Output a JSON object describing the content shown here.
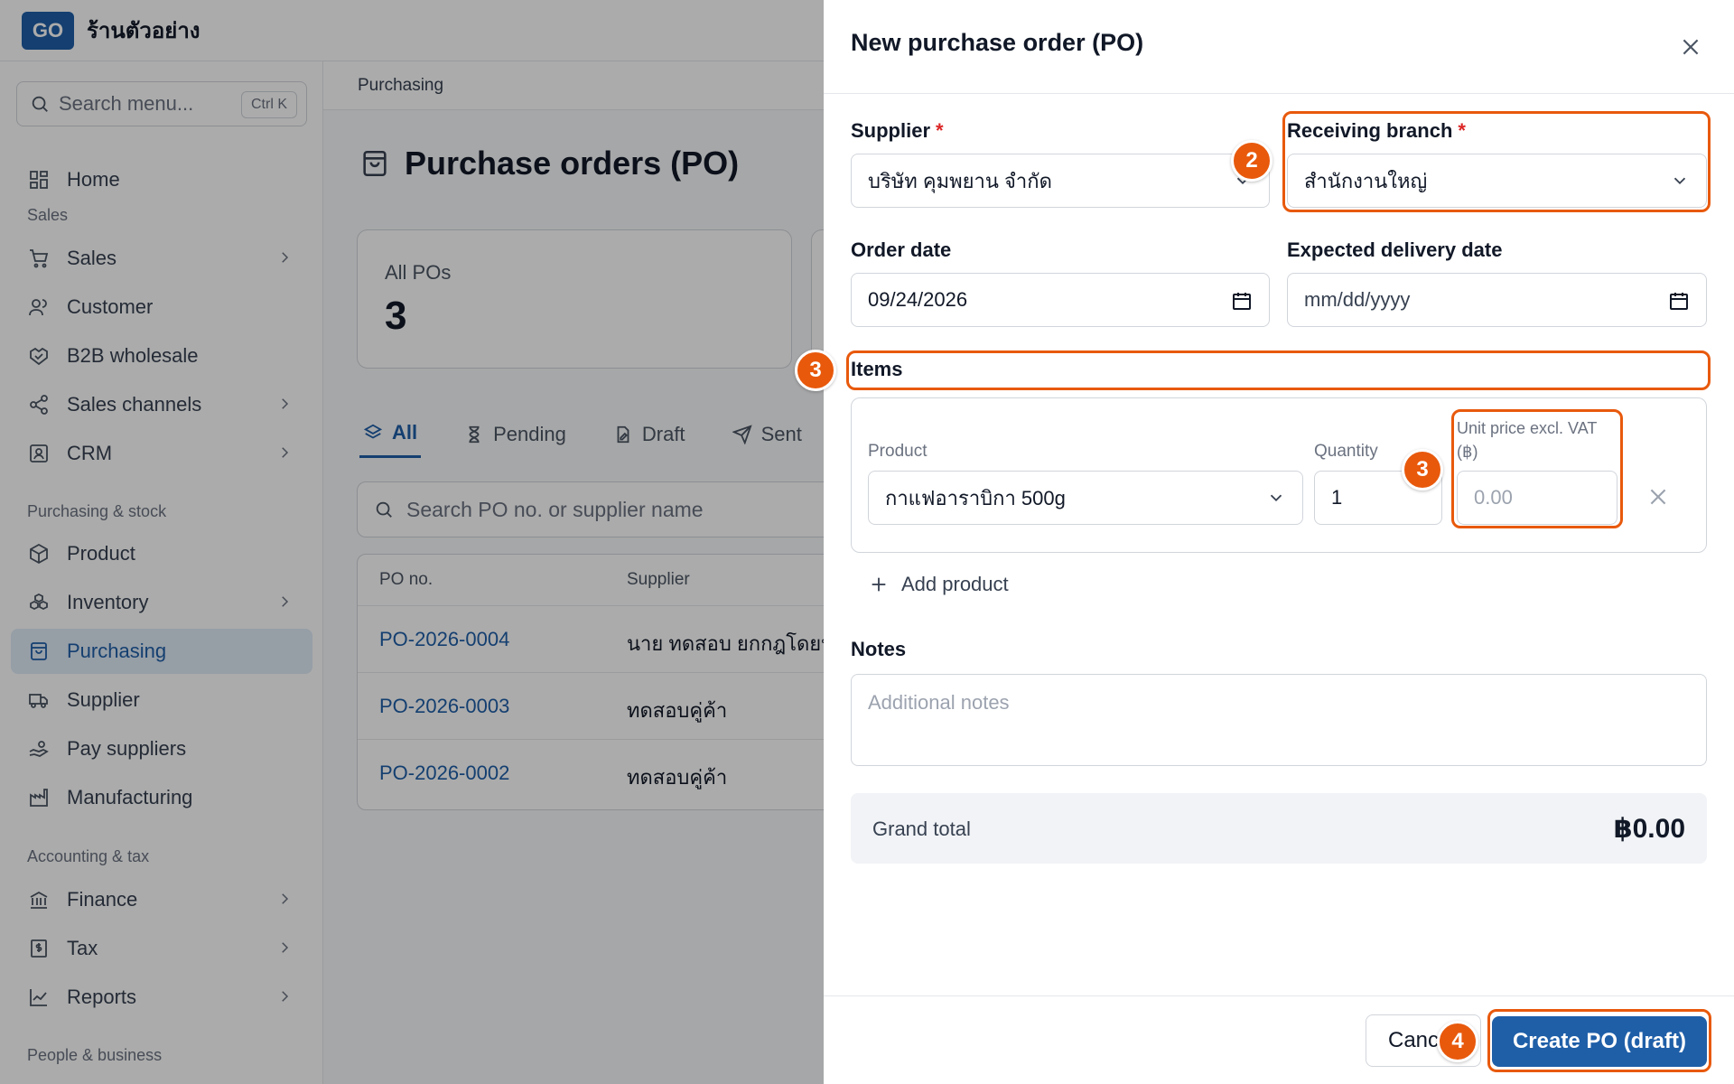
{
  "app": {
    "logo": "GO",
    "shop_name": "ร้านตัวอย่าง"
  },
  "sidebar": {
    "search_placeholder": "Search menu...",
    "search_shortcut": "Ctrl K",
    "home": "Home",
    "sections": {
      "sales": "Sales",
      "purchasing": "Purchasing & stock",
      "accounting": "Accounting & tax",
      "people": "People & business"
    },
    "items": {
      "sales": "Sales",
      "customer": "Customer",
      "b2b": "B2B wholesale",
      "channels": "Sales channels",
      "crm": "CRM",
      "product": "Product",
      "inventory": "Inventory",
      "purchasing": "Purchasing",
      "supplier": "Supplier",
      "pay_suppliers": "Pay suppliers",
      "manufacturing": "Manufacturing",
      "finance": "Finance",
      "tax": "Tax",
      "reports": "Reports"
    }
  },
  "main": {
    "breadcrumb": "Purchasing",
    "title": "Purchase orders (PO)",
    "stat": {
      "label": "All POs",
      "value": "3"
    },
    "tabs": [
      "All",
      "Pending",
      "Draft",
      "Sent"
    ],
    "search_placeholder": "Search PO no. or supplier name",
    "table": {
      "headers": [
        "PO no.",
        "Supplier"
      ],
      "rows": [
        {
          "po": "PO-2026-0004",
          "supplier": "นาย ทดสอบ ยกกฎโดยบั"
        },
        {
          "po": "PO-2026-0003",
          "supplier": "ทดสอบคู่ค้า"
        },
        {
          "po": "PO-2026-0002",
          "supplier": "ทดสอบคู่ค้า"
        }
      ]
    }
  },
  "drawer": {
    "title": "New purchase order (PO)",
    "supplier_label": "Supplier",
    "supplier_value": "บริษัท คุมพยาน จำกัด",
    "branch_label": "Receiving branch",
    "branch_value": "สำนักงานใหญ่",
    "required_mark": "*",
    "order_date_label": "Order date",
    "order_date_value": "09/24/2026",
    "delivery_date_label": "Expected delivery date",
    "delivery_date_placeholder": "mm/dd/yyyy",
    "items_label": "Items",
    "product_label": "Product",
    "product_value": "กาแฟอาราบิกา 500g",
    "quantity_label": "Quantity",
    "quantity_value": "1",
    "unit_price_label_1": "Unit price excl. VAT",
    "unit_price_label_2": "(฿)",
    "unit_price_placeholder": "0.00",
    "add_product": "Add product",
    "notes_label": "Notes",
    "notes_placeholder": "Additional notes",
    "grand_total_label": "Grand total",
    "grand_total_value": "฿0.00",
    "cancel_label": "Cancel",
    "create_label": "Create PO (draft)"
  },
  "annotations": {
    "step_2": "2",
    "step_3a": "3",
    "step_3b": "3",
    "step_4": "4",
    "color": "#e8590c"
  }
}
